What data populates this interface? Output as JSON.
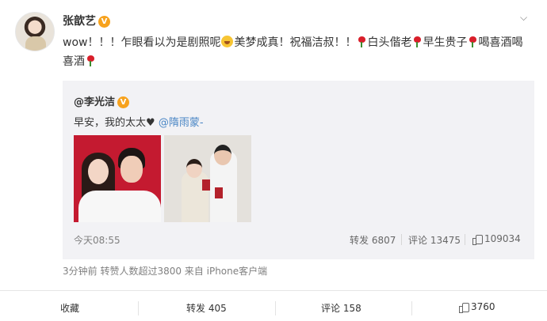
{
  "post": {
    "username": "张歆艺",
    "verified_badge": "V",
    "text_part1": "wow！！！乍眼看以为是剧照呢",
    "text_part2": "美梦成真！祝福洁叔！！",
    "text_part3": "白头偕老",
    "text_part4": "早生贵子",
    "text_part5": "喝喜酒喝喜酒",
    "meta": "3分钟前 转赞人数超过3800 来自 iPhone客户端"
  },
  "repost": {
    "username": "@李光洁",
    "verified_badge": "V",
    "text": "早安，我的太太",
    "heart": "♥",
    "mention": "@隋雨蒙-",
    "time": "今天08:55",
    "forward_label": "转发 6807",
    "comment_label": "评论 13475",
    "like_count": "109034"
  },
  "actions": {
    "collect": "收藏",
    "forward": "转发 405",
    "comment": "评论 158",
    "like": "3760"
  },
  "icons": {
    "menu": "chevron-down-icon",
    "badge": "verified-badge-icon",
    "rose": "rose-emoji-icon",
    "laugh": "laughing-emoji-icon",
    "like": "thumbs-up-icon"
  },
  "colors": {
    "link": "#4a86c5",
    "badge": "#f7a21d",
    "repost_bg": "#f2f2f5"
  }
}
